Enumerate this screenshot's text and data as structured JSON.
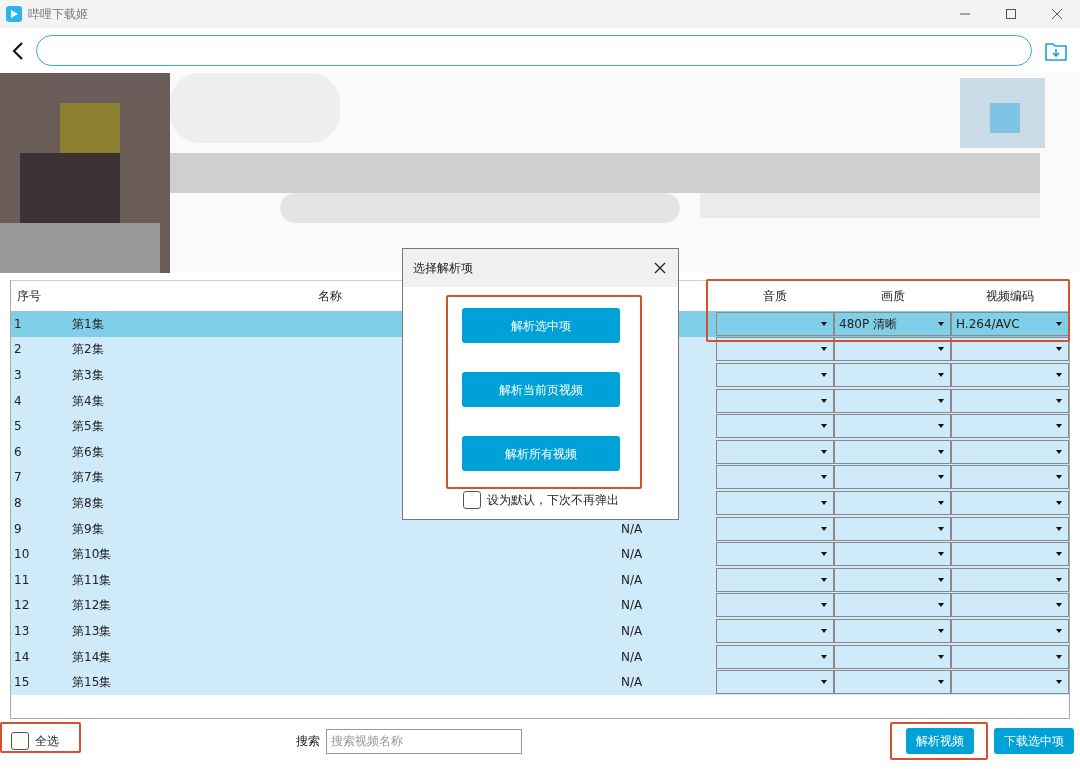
{
  "window": {
    "title": "哔哩下载姬"
  },
  "table": {
    "columns": {
      "index": "序号",
      "name": "名称",
      "audio": "音质",
      "quality": "画质",
      "codec": "视频编码"
    },
    "stream_columns_highlighted": true,
    "rows": [
      {
        "index": "1",
        "name": "第1集",
        "selected": true,
        "quality": "480P 清晰",
        "codec": "H.264/AVC"
      },
      {
        "index": "2",
        "name": "第2集",
        "selected": false
      },
      {
        "index": "3",
        "name": "第3集",
        "selected": false
      },
      {
        "index": "4",
        "name": "第4集",
        "selected": false
      },
      {
        "index": "5",
        "name": "第5集",
        "selected": false
      },
      {
        "index": "6",
        "name": "第6集",
        "selected": false
      },
      {
        "index": "7",
        "name": "第7集",
        "selected": false
      },
      {
        "index": "8",
        "name": "第8集",
        "selected": false
      },
      {
        "index": "9",
        "name": "第9集",
        "selected": false,
        "column_3": "N/A"
      },
      {
        "index": "10",
        "name": "第10集",
        "selected": false,
        "column_3": "N/A"
      },
      {
        "index": "11",
        "name": "第11集",
        "selected": false,
        "column_3": "N/A"
      },
      {
        "index": "12",
        "name": "第12集",
        "selected": false,
        "column_3": "N/A"
      },
      {
        "index": "13",
        "name": "第13集",
        "selected": false,
        "column_3": "N/A"
      },
      {
        "index": "14",
        "name": "第14集",
        "selected": false,
        "column_3": "N/A"
      },
      {
        "index": "15",
        "name": "第15集",
        "selected": false,
        "column_3": "N/A"
      }
    ]
  },
  "dialog": {
    "title": "选择解析项",
    "options": [
      "解析选中项",
      "解析当前页视频",
      "解析所有视频"
    ],
    "options_highlighted": true,
    "dont_show_again": {
      "label": "设为默认，下次不再弹出",
      "checked": false
    }
  },
  "footer": {
    "select_all": {
      "label": "全选",
      "checked": false,
      "highlighted": true
    },
    "search": {
      "label": "搜索",
      "placeholder": "搜索视频名称"
    },
    "buttons": [
      {
        "label": "解析视频",
        "highlighted": true
      },
      {
        "label": "下载选中项",
        "highlighted": false
      }
    ]
  }
}
